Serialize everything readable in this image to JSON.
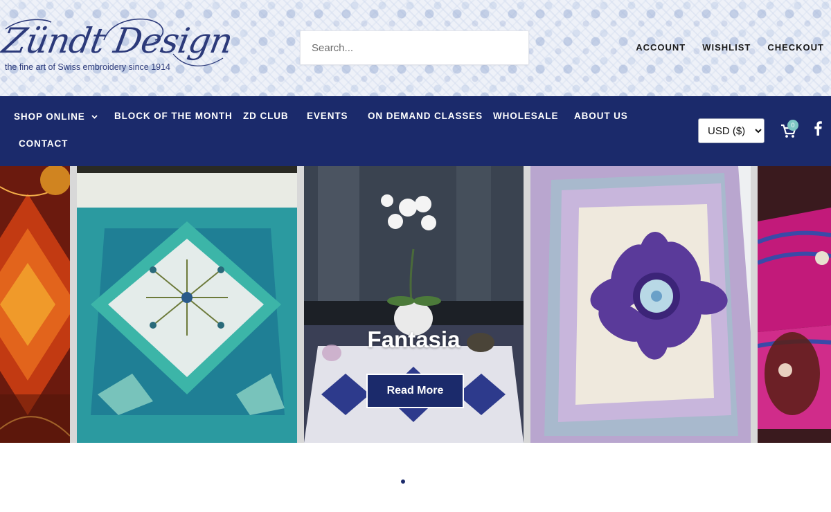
{
  "brand": {
    "name": "Zündt Design",
    "tagline": "the fine art of Swiss embroidery since 1914"
  },
  "search": {
    "placeholder": "Search...",
    "value": ""
  },
  "account_links": [
    "ACCOUNT",
    "WISHLIST",
    "CHECKOUT"
  ],
  "nav": {
    "items": [
      {
        "label": "SHOP ONLINE",
        "has_dropdown": true
      },
      {
        "label": "BLOCK OF THE MONTH"
      },
      {
        "label": "ZD CLUB"
      },
      {
        "label": "EVENTS"
      },
      {
        "label": "ON DEMAND CLASSES"
      },
      {
        "label": "WHOLESALE"
      },
      {
        "label": "ABOUT US"
      },
      {
        "label": "CONTACT"
      }
    ],
    "currency": {
      "selected": "USD ($)"
    },
    "cart": {
      "count": "0",
      "icon": "shopping-cart-icon"
    },
    "social": {
      "icon": "facebook-icon"
    }
  },
  "carousel": {
    "active_slide": {
      "title": "Fantasia",
      "button_label": "Read More"
    },
    "pagination_dots": 1
  },
  "colors": {
    "brand_navy": "#1b2a6b",
    "cart_badge": "#7ec7c4"
  }
}
